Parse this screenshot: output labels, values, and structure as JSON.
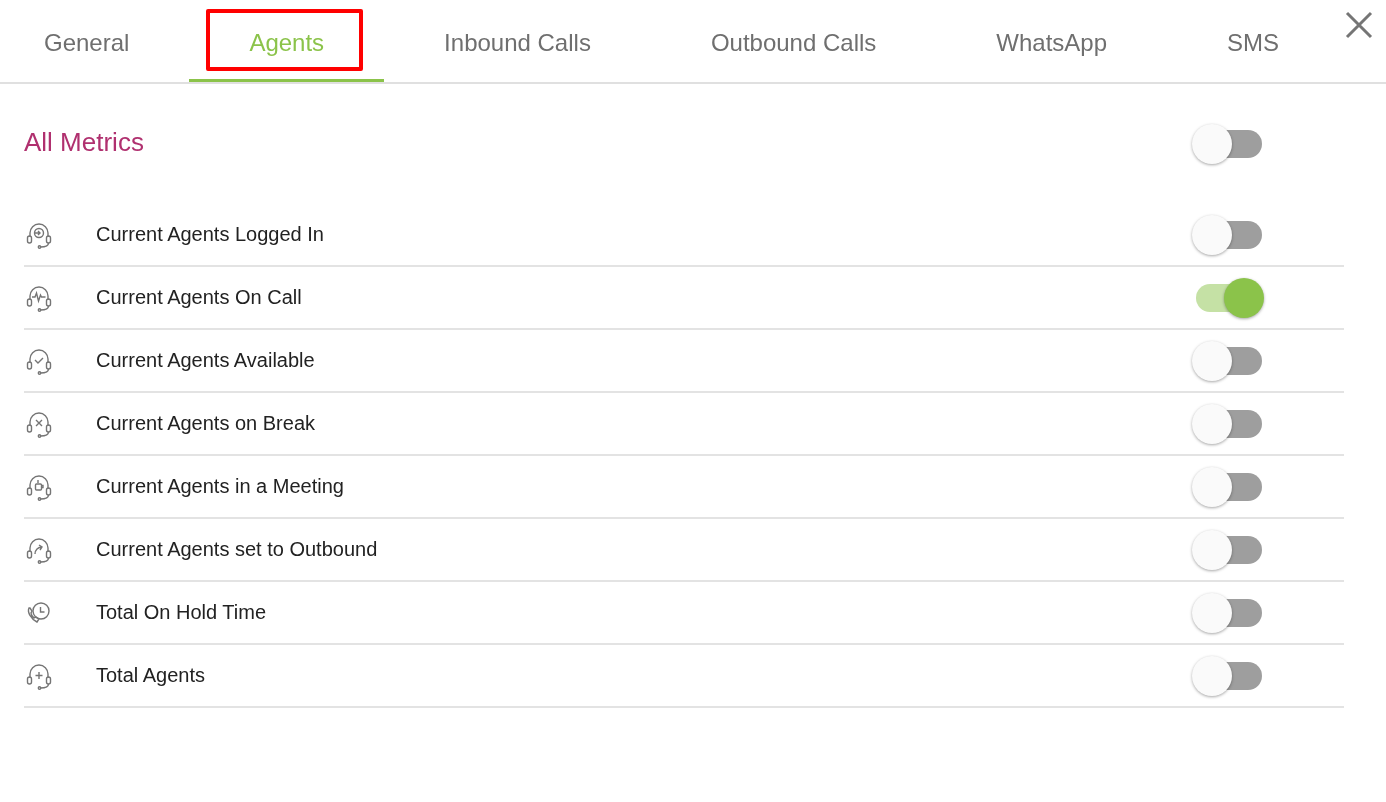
{
  "tabs": [
    {
      "label": "General",
      "selected": false,
      "annotated": false
    },
    {
      "label": "Agents",
      "selected": true,
      "annotated": true
    },
    {
      "label": "Inbound Calls",
      "selected": false,
      "annotated": false
    },
    {
      "label": "Outbound Calls",
      "selected": false,
      "annotated": false
    },
    {
      "label": "WhatsApp",
      "selected": false,
      "annotated": false
    },
    {
      "label": "SMS",
      "selected": false,
      "annotated": false
    }
  ],
  "all_metrics": {
    "label": "All Metrics",
    "on": false
  },
  "metrics": [
    {
      "kind": "login",
      "label": "Current Agents Logged In",
      "on": false
    },
    {
      "kind": "on-call",
      "label": "Current Agents On Call",
      "on": true
    },
    {
      "kind": "available",
      "label": "Current Agents Available",
      "on": false
    },
    {
      "kind": "break",
      "label": "Current Agents on Break",
      "on": false
    },
    {
      "kind": "meeting",
      "label": "Current Agents in a Meeting",
      "on": false
    },
    {
      "kind": "outbound",
      "label": "Current Agents set to Outbound",
      "on": false
    },
    {
      "kind": "hold",
      "label": "Total On Hold Time",
      "on": false
    },
    {
      "kind": "total",
      "label": "Total Agents",
      "on": false
    }
  ]
}
